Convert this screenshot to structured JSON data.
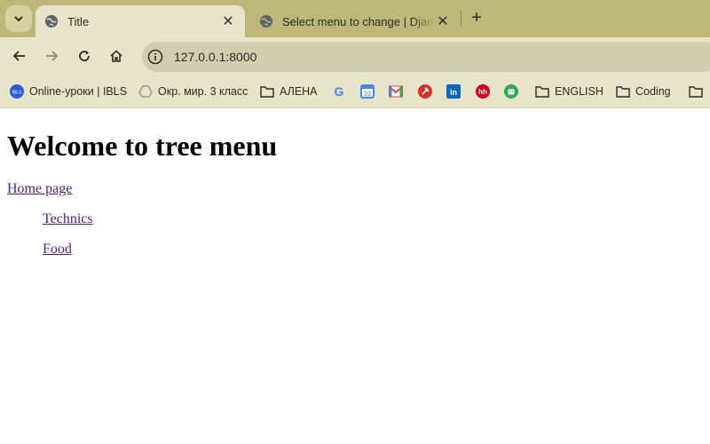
{
  "browser": {
    "tabs": [
      {
        "title": "Title",
        "active": true
      },
      {
        "title": "Select menu to change | Django site admin",
        "active": false
      }
    ],
    "url": "127.0.0.1:8000",
    "bookmarks": [
      {
        "label": "Online-уроки | IBLS",
        "icon": "ibls-icon"
      },
      {
        "label": "Окр. мир. 3 класс",
        "icon": "drive-icon"
      },
      {
        "label": "АЛЕНА",
        "icon": "folder-icon"
      },
      {
        "label": "",
        "icon": "google-icon"
      },
      {
        "label": "",
        "icon": "calendar-icon"
      },
      {
        "label": "",
        "icon": "gmail-icon"
      },
      {
        "label": "",
        "icon": "tool-icon"
      },
      {
        "label": "",
        "icon": "linkedin-icon"
      },
      {
        "label": "",
        "icon": "hh-icon"
      },
      {
        "label": "",
        "icon": "android-icon"
      },
      {
        "label": "ENGLISH",
        "icon": "folder-icon"
      },
      {
        "label": "Coding",
        "icon": "folder-icon"
      }
    ]
  },
  "page": {
    "heading": "Welcome to tree menu",
    "menu": {
      "root": "Home page",
      "children": [
        "Technics",
        "Food"
      ]
    }
  }
}
